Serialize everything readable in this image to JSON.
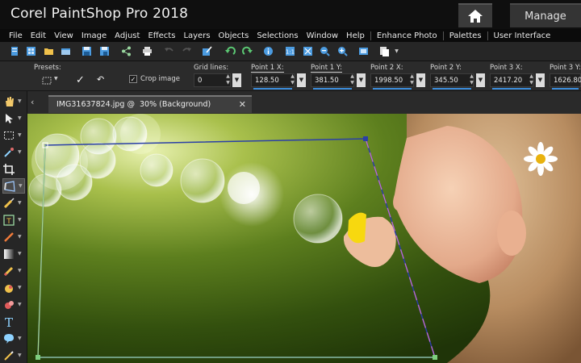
{
  "app": {
    "title": "Corel® PaintShop® Pro 2018",
    "title_display": "Corel PaintShop Pro 2018"
  },
  "workspace_tabs": {
    "home_icon": "home-icon",
    "manage": "Manage"
  },
  "menu": {
    "items": [
      "File",
      "Edit",
      "View",
      "Image",
      "Adjust",
      "Effects",
      "Layers",
      "Objects",
      "Selections",
      "Window",
      "Help"
    ],
    "extra": [
      "Enhance Photo",
      "Palettes",
      "User Interface"
    ]
  },
  "toolbar": {
    "icons": [
      "new-icon",
      "open-icon",
      "folder-icon",
      "scan-icon",
      "save-icon",
      "save-as-icon",
      "share-icon",
      "print-icon",
      "undo-icon",
      "redo-icon",
      "edit-icon",
      "rotate-left-icon",
      "rotate-right-icon",
      "info-icon",
      "actual-size-icon",
      "fit-icon",
      "zoom-out-icon",
      "zoom-in-icon",
      "fullscreen-icon",
      "paste-icon"
    ]
  },
  "options": {
    "presets_label": "Presets:",
    "crop_image_label": "Crop image",
    "crop_image_checked": true,
    "grid_lines_label": "Grid lines:",
    "grid_lines_value": "0",
    "points": [
      {
        "label": "Point 1 X:",
        "value": "128.50"
      },
      {
        "label": "Point 1 Y:",
        "value": "381.50"
      },
      {
        "label": "Point 2 X:",
        "value": "1998.50"
      },
      {
        "label": "Point 2 Y:",
        "value": "345.50"
      },
      {
        "label": "Point 3 X:",
        "value": "2417.20"
      },
      {
        "label": "Point 3 Y:",
        "value": "1626.80"
      }
    ]
  },
  "tools": {
    "items": [
      "pan-icon",
      "pick-icon",
      "selection-icon",
      "dropper-icon",
      "crop-icon",
      "perspective-correction-icon",
      "move-icon",
      "straighten-icon",
      "red-eye-icon",
      "paint-brush-icon",
      "gradient-icon",
      "eraser-icon",
      "fill-icon",
      "picture-tube-icon",
      "text-icon",
      "shape-icon",
      "pen-icon"
    ],
    "active_index": 5
  },
  "document": {
    "tab_label": "IMG31637824.jpg @  30% (Background)",
    "close_icon": "close-icon",
    "nav_icon": "chevron-left-icon"
  },
  "colors": {
    "accent": "#3b8cd9",
    "titlebar": "#0f0f0f",
    "menubar": "#0b0b0b",
    "panel": "#2b2b2b"
  }
}
